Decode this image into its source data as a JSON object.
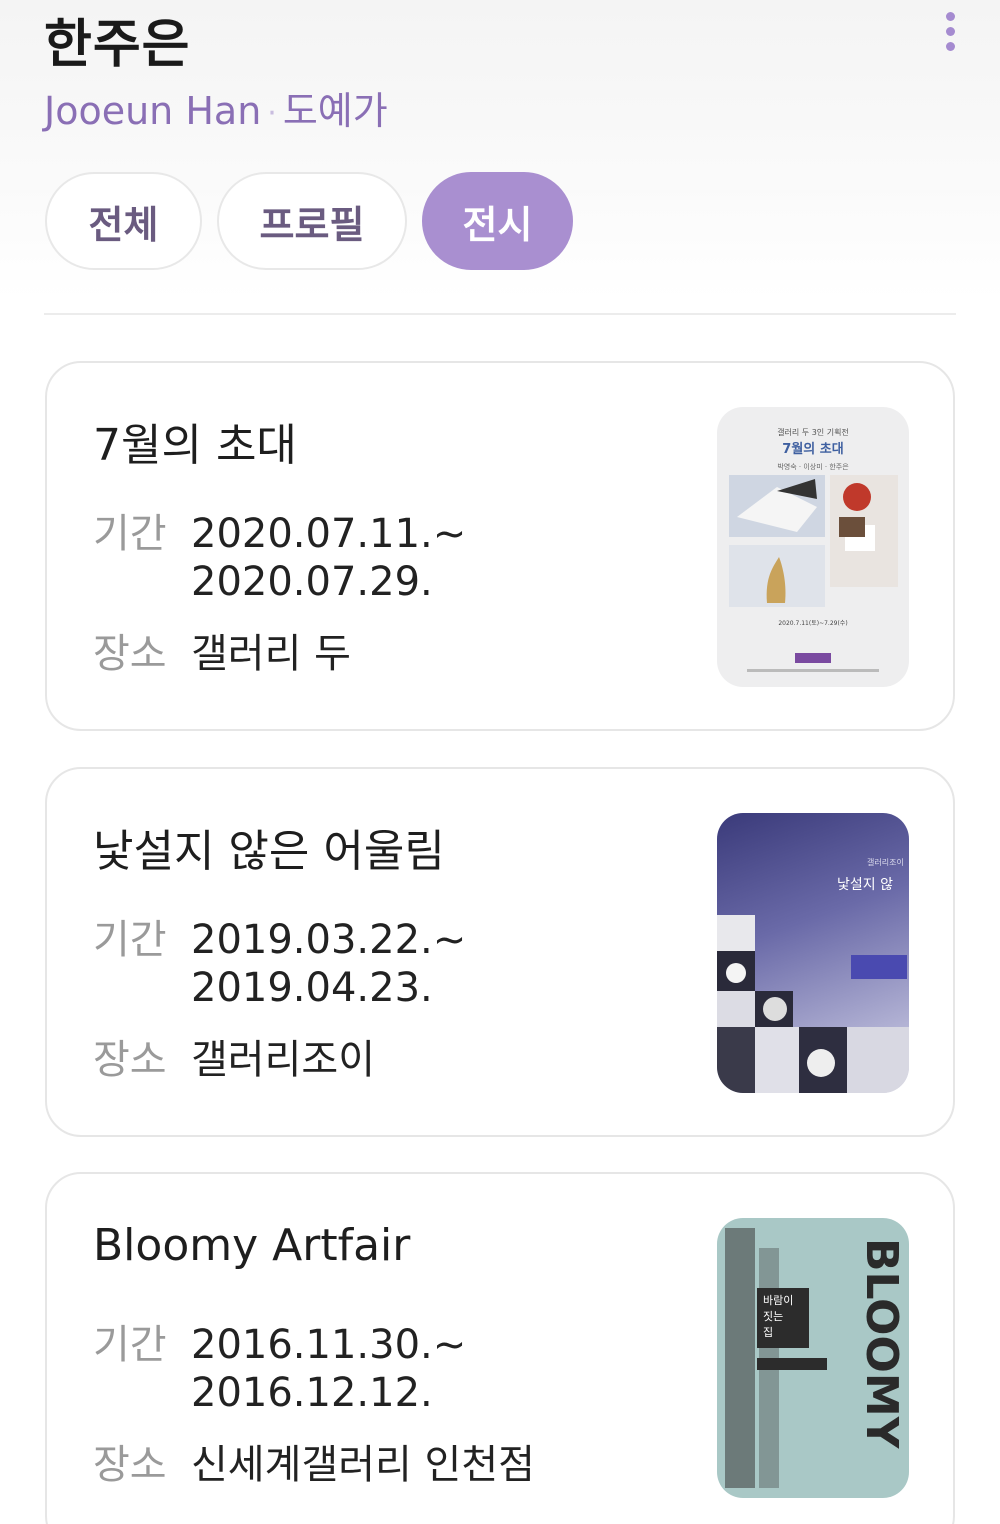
{
  "profile": {
    "name": "한주은",
    "english_name": "Jooeun Han",
    "separator": "·",
    "occupation": "도예가"
  },
  "tabs": [
    {
      "label": "전체",
      "active": false
    },
    {
      "label": "프로필",
      "active": false
    },
    {
      "label": "전시",
      "active": true
    }
  ],
  "exhibitions": [
    {
      "title": "7월의 초대",
      "period_label": "기간",
      "start": "2020.07.11.~",
      "end": "2020.07.29.",
      "place_label": "장소",
      "place": "갤러리 두",
      "poster": {
        "header": "갤러리 두 3인 기획전",
        "title": "7월의 초대",
        "artists": "박영숙 · 이상미 · 한주은",
        "dates": "2020.7.11(토)~7.29(수)"
      }
    },
    {
      "title": "낯설지 않은 어울림",
      "period_label": "기간",
      "start": "2019.03.22.~",
      "end": "2019.04.23.",
      "place_label": "장소",
      "place": "갤러리조이",
      "poster": {
        "header": "갤러리조이",
        "title": "낯설지 않"
      }
    },
    {
      "title": "Bloomy Artfair",
      "period_label": "기간",
      "start": "2016.11.30.~",
      "end": "2016.12.12.",
      "place_label": "장소",
      "place": "신세계갤러리 인천점",
      "poster": {
        "title": "바람이 짓는 집",
        "word": "BLOOMY"
      }
    }
  ],
  "colors": {
    "accent": "#a98fd0",
    "subtitle": "#8a6fb5"
  }
}
